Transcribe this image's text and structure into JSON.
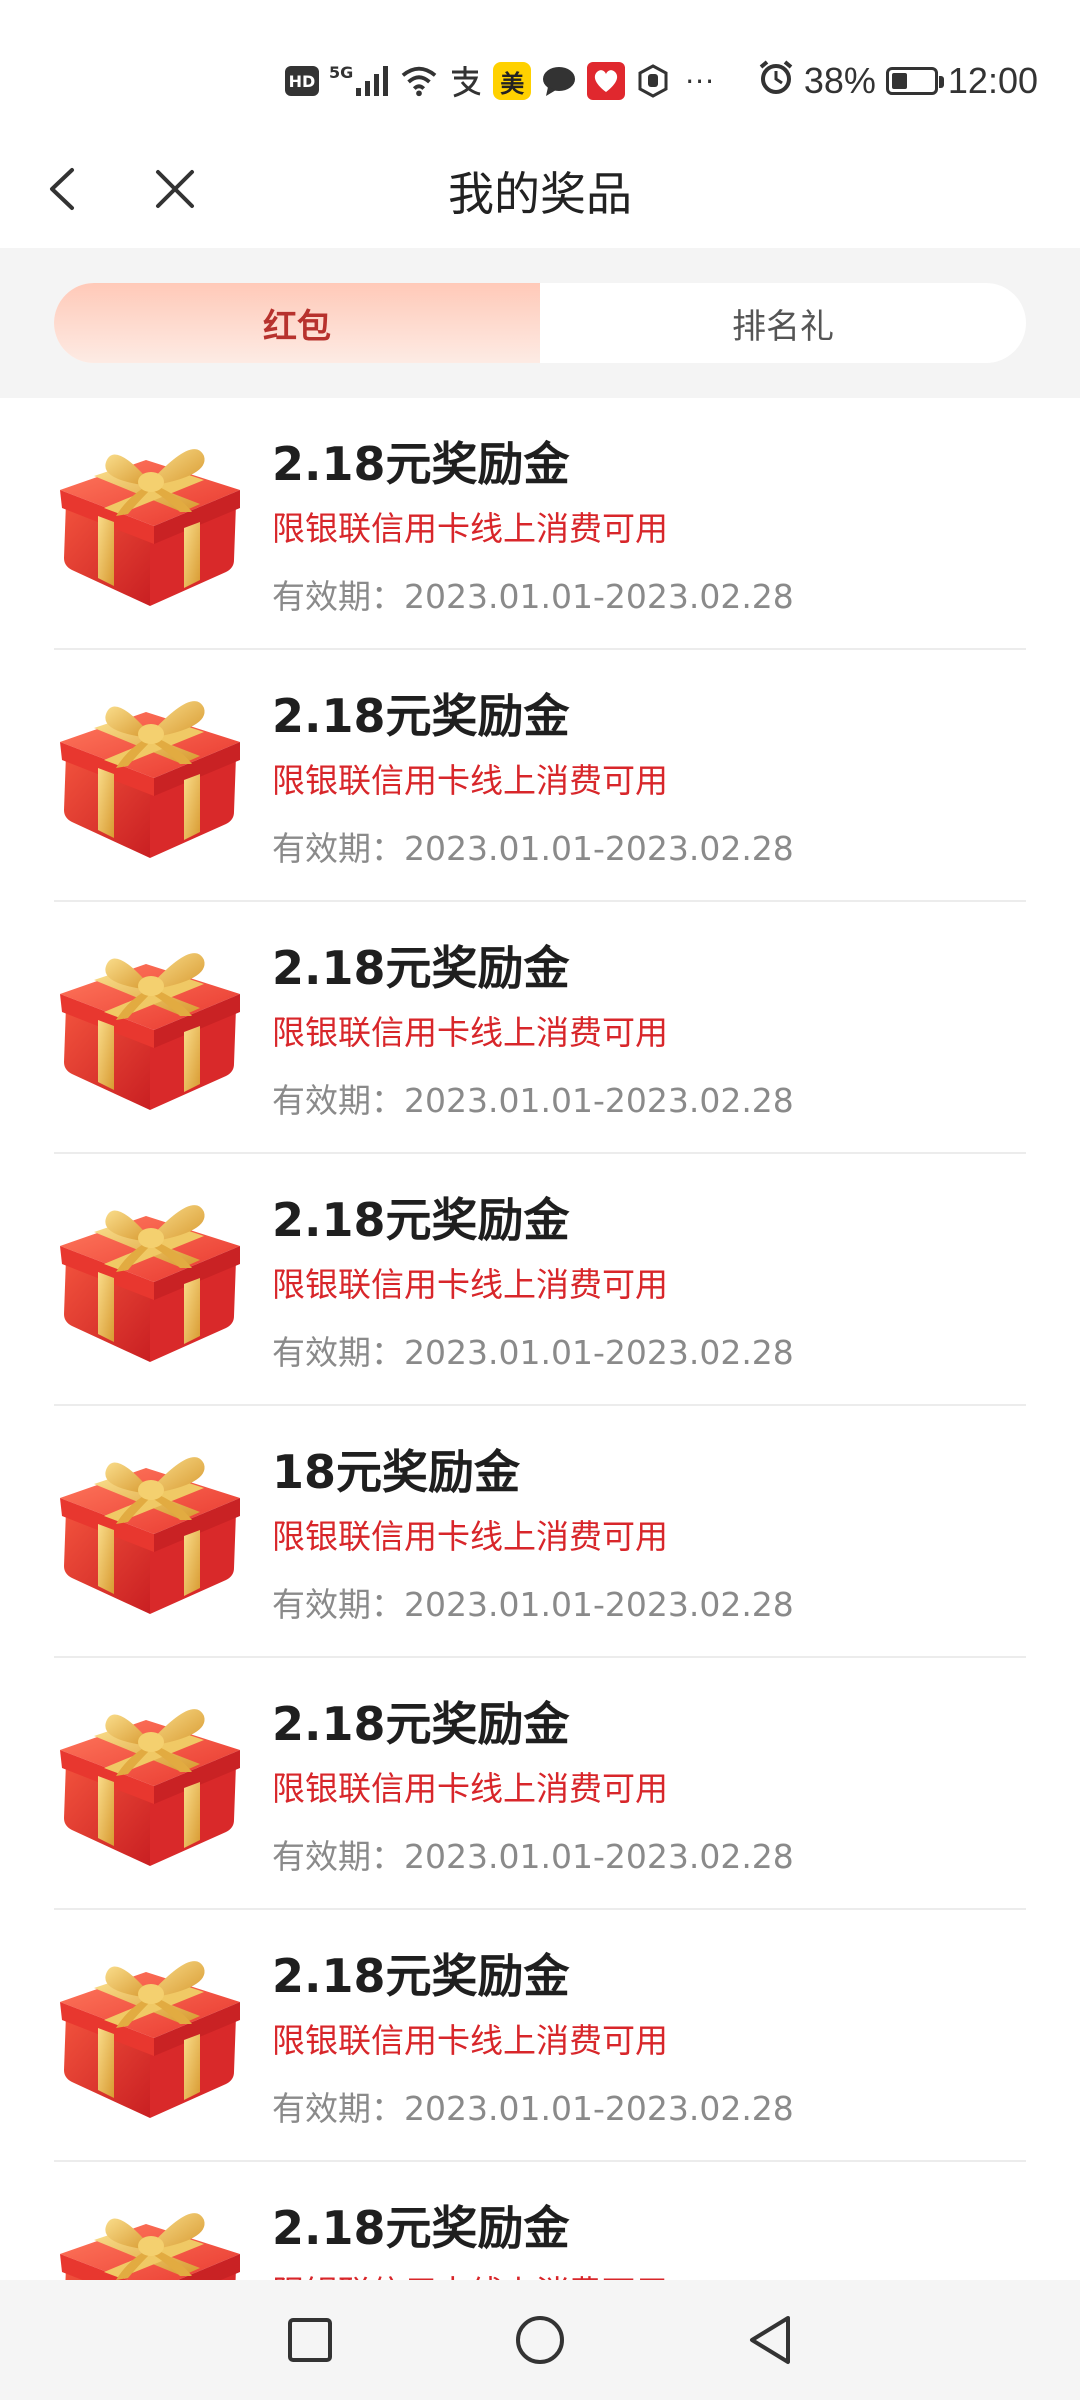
{
  "status_bar": {
    "network": "5G",
    "hd": "HD",
    "mei": "美",
    "more": "···",
    "battery_percent_text": "38%",
    "battery_level": 0.38,
    "time": "12:00"
  },
  "nav": {
    "title": "我的奖品"
  },
  "tabs": [
    {
      "label": "红包",
      "active": true
    },
    {
      "label": "排名礼",
      "active": false
    }
  ],
  "prizes": [
    {
      "title": "2.18元奖励金",
      "desc": "限银联信用卡线上消费可用",
      "validity": "有效期：2023.01.01-2023.02.28"
    },
    {
      "title": "2.18元奖励金",
      "desc": "限银联信用卡线上消费可用",
      "validity": "有效期：2023.01.01-2023.02.28"
    },
    {
      "title": "2.18元奖励金",
      "desc": "限银联信用卡线上消费可用",
      "validity": "有效期：2023.01.01-2023.02.28"
    },
    {
      "title": "2.18元奖励金",
      "desc": "限银联信用卡线上消费可用",
      "validity": "有效期：2023.01.01-2023.02.28"
    },
    {
      "title": "18元奖励金",
      "desc": "限银联信用卡线上消费可用",
      "validity": "有效期：2023.01.01-2023.02.28"
    },
    {
      "title": "2.18元奖励金",
      "desc": "限银联信用卡线上消费可用",
      "validity": "有效期：2023.01.01-2023.02.28"
    },
    {
      "title": "2.18元奖励金",
      "desc": "限银联信用卡线上消费可用",
      "validity": "有效期：2023.01.01-2023.02.28"
    },
    {
      "title": "2.18元奖励金",
      "desc": "限银联信用卡线上消费可用",
      "validity": ""
    }
  ],
  "colors": {
    "accent_red": "#d8262a",
    "tab_active_text": "#b7322d",
    "gift_red": "#e8372f",
    "gift_gold": "#e8b64a"
  }
}
